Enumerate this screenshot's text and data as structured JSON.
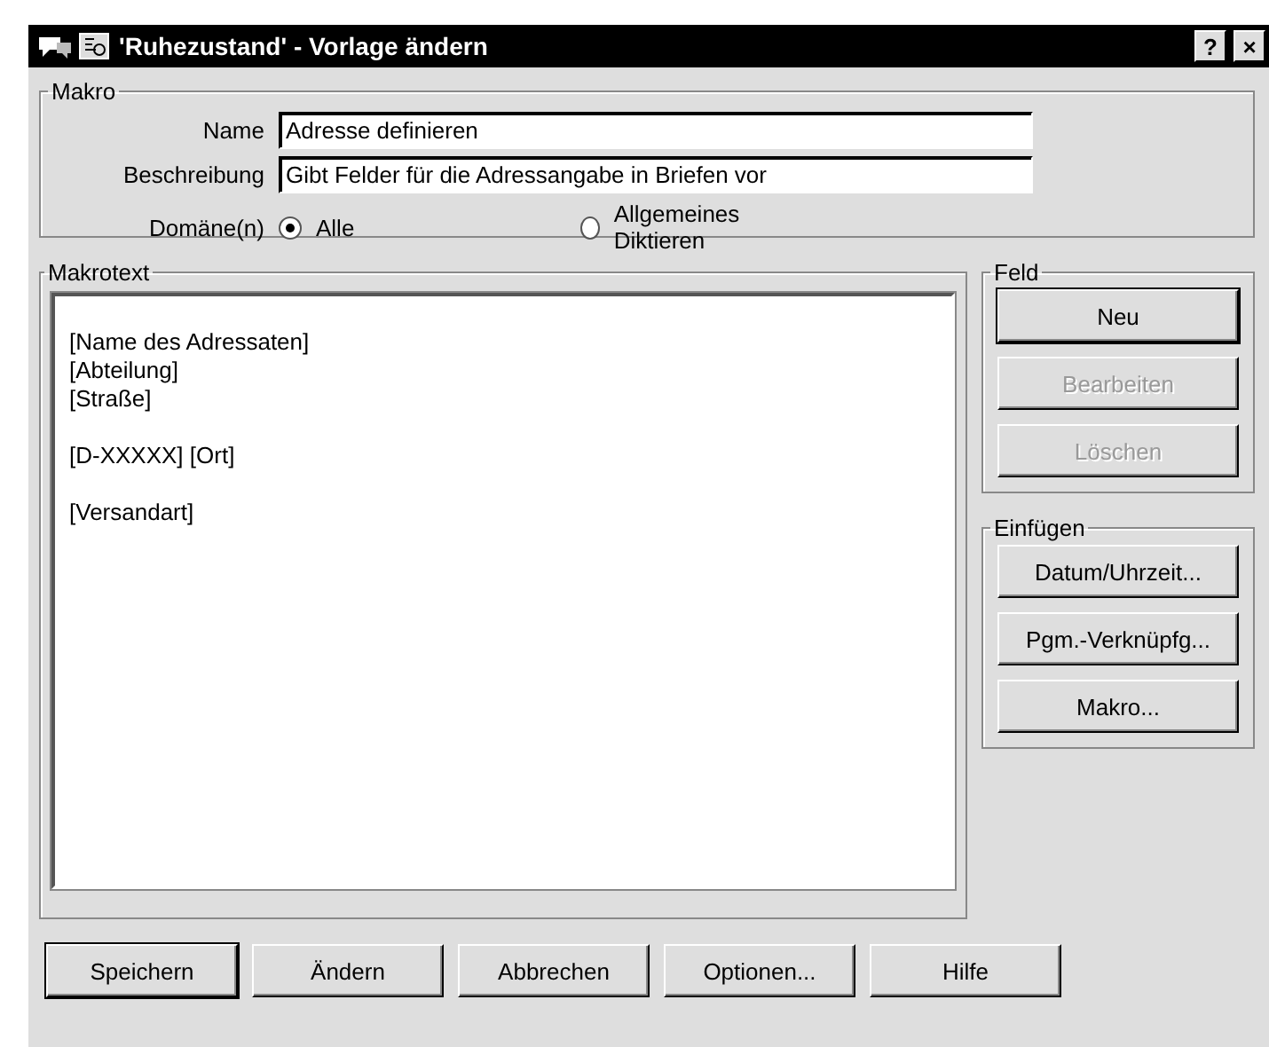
{
  "window": {
    "title": "'Ruhezustand' - Vorlage ändern",
    "help_button": "?",
    "close_button": "×"
  },
  "makro": {
    "legend": "Makro",
    "fields": [
      {
        "label": "Name",
        "value": "Adresse definieren"
      },
      {
        "label": "Beschreibung",
        "value": "Gibt Felder für die Adressangabe in Briefen vor"
      }
    ],
    "domain_label": "Domäne(n)",
    "domains": [
      {
        "label": "Alle",
        "selected": true
      },
      {
        "label": "Allgemeines Diktieren",
        "selected": false
      }
    ]
  },
  "makrotext": {
    "legend": "Makrotext",
    "value": "\n[Name des Adressaten]\n[Abteilung]\n[Straße]\n\n[D-XXXXX] [Ort]\n\n[Versandart]"
  },
  "feld": {
    "legend": "Feld",
    "buttons": [
      {
        "label": "Neu",
        "disabled": false,
        "default": true
      },
      {
        "label": "Bearbeiten",
        "disabled": true,
        "default": false
      },
      {
        "label": "Löschen",
        "disabled": true,
        "default": false
      }
    ]
  },
  "einfuegen": {
    "legend": "Einfügen",
    "buttons": [
      {
        "label": "Datum/Uhrzeit...",
        "disabled": false,
        "default": false
      },
      {
        "label": "Pgm.-Verknüpfg...",
        "disabled": false,
        "default": false
      },
      {
        "label": "Makro...",
        "disabled": false,
        "default": false
      }
    ]
  },
  "buttons": [
    {
      "label": "Speichern",
      "disabled": false,
      "default": true
    },
    {
      "label": "Ändern",
      "disabled": false,
      "default": false
    },
    {
      "label": "Abbrechen",
      "disabled": false,
      "default": false
    },
    {
      "label": "Optionen...",
      "disabled": false,
      "default": false
    },
    {
      "label": "Hilfe",
      "disabled": false,
      "default": false
    }
  ]
}
